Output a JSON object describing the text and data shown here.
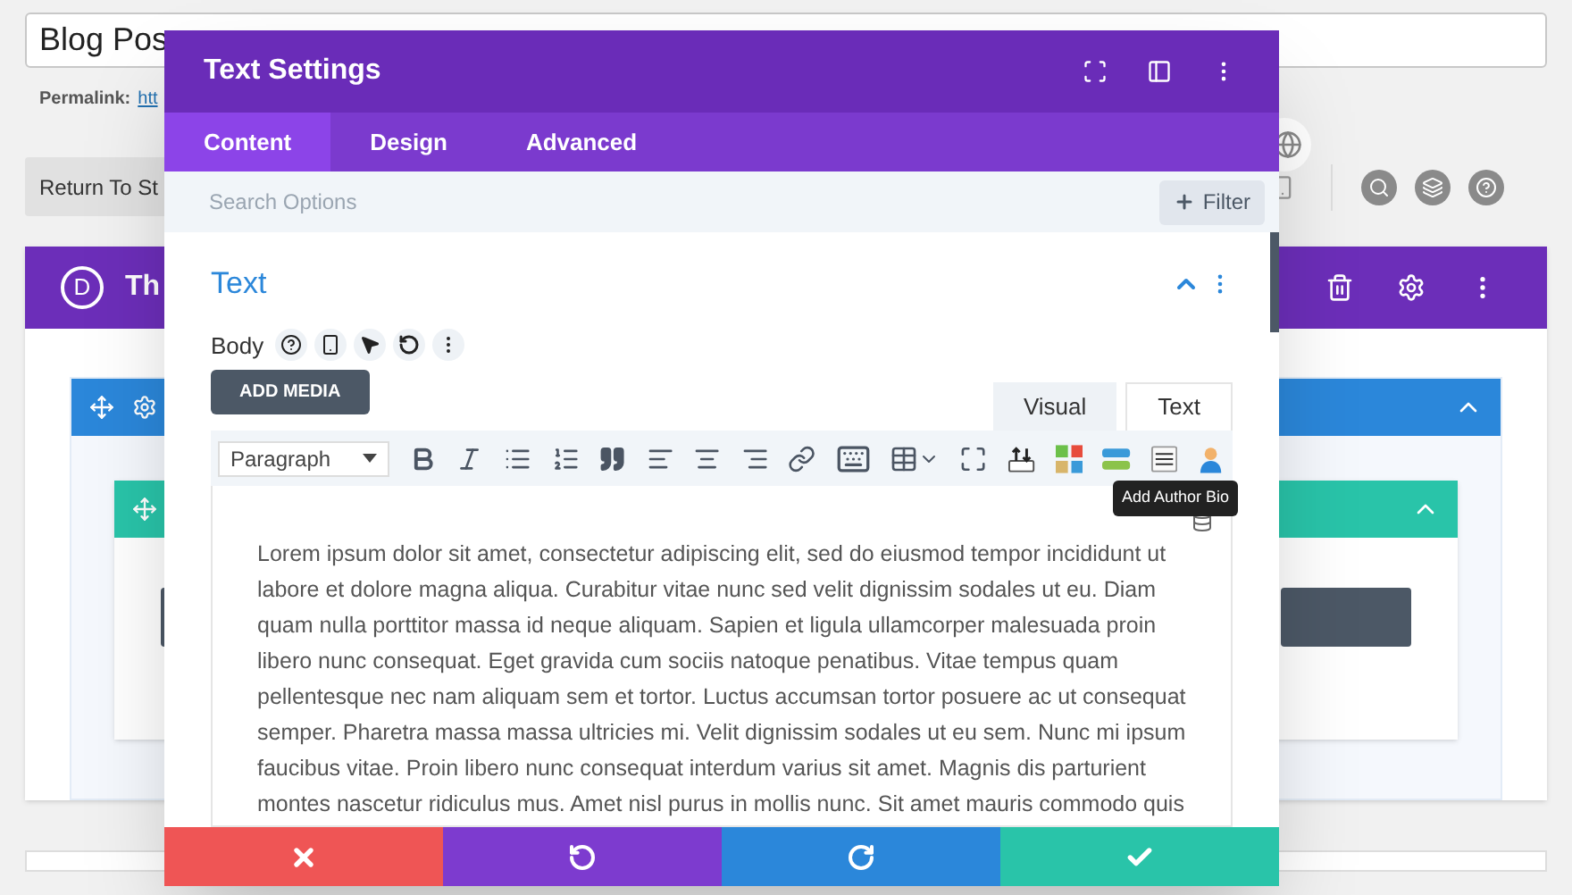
{
  "page": {
    "title_field": {
      "value": "Blog Pos"
    },
    "permalink": {
      "label": "Permalink:",
      "link": "htt"
    },
    "return_button": "Return To St",
    "builder": {
      "logo": "D",
      "title": "Th"
    }
  },
  "modal": {
    "title": "Text Settings",
    "tabs": [
      {
        "label": "Content",
        "selected": true
      },
      {
        "label": "Design",
        "selected": false
      },
      {
        "label": "Advanced",
        "selected": false
      }
    ],
    "search": {
      "placeholder": "Search Options"
    },
    "filter_button": "Filter",
    "section_title": "Text",
    "field_label": "Body",
    "add_media": "ADD MEDIA",
    "editor_tabs": [
      {
        "label": "Visual",
        "selected": false
      },
      {
        "label": "Text",
        "selected": true
      }
    ],
    "format_select": "Paragraph",
    "toolbar": [
      {
        "kind": "bold"
      },
      {
        "kind": "italic"
      },
      {
        "kind": "bullets"
      },
      {
        "kind": "numbers"
      },
      {
        "kind": "quote"
      },
      {
        "kind": "left"
      },
      {
        "kind": "center"
      },
      {
        "kind": "right"
      },
      {
        "kind": "link"
      },
      {
        "kind": "keyboard"
      },
      {
        "kind": "table"
      },
      {
        "kind": "fullscreen"
      },
      {
        "kind": "upload"
      },
      {
        "kind": "blocks"
      },
      {
        "kind": "bars"
      },
      {
        "kind": "lines"
      },
      {
        "kind": "author"
      }
    ],
    "tooltip": "Add Author Bio",
    "body": "Lorem ipsum dolor sit amet, consectetur adipiscing elit, sed do eiusmod tempor incididunt ut labore et dolore magna aliqua. Curabitur vitae nunc sed velit dignissim sodales ut eu. Diam quam nulla porttitor massa id neque aliquam. Sapien et ligula ullamcorper malesuada proin libero nunc consequat. Eget gravida cum sociis natoque penatibus. Vitae tempus quam pellentesque nec nam aliquam sem et tortor. Luctus accumsan tortor posuere ac ut consequat semper. Pharetra massa massa ultricies mi. Velit dignissim sodales ut eu sem. Nunc mi ipsum faucibus vitae. Proin libero nunc consequat interdum varius sit amet. Magnis dis parturient montes nascetur ridiculus mus. Amet nisl purus in mollis nunc. Sit amet mauris commodo quis",
    "footer": [
      {
        "kind": "cancel",
        "color": "#ef5555"
      },
      {
        "kind": "undo",
        "color": "#7d3bcf"
      },
      {
        "kind": "redo",
        "color": "#2b87da"
      },
      {
        "kind": "save",
        "color": "#29c4a9"
      }
    ]
  }
}
